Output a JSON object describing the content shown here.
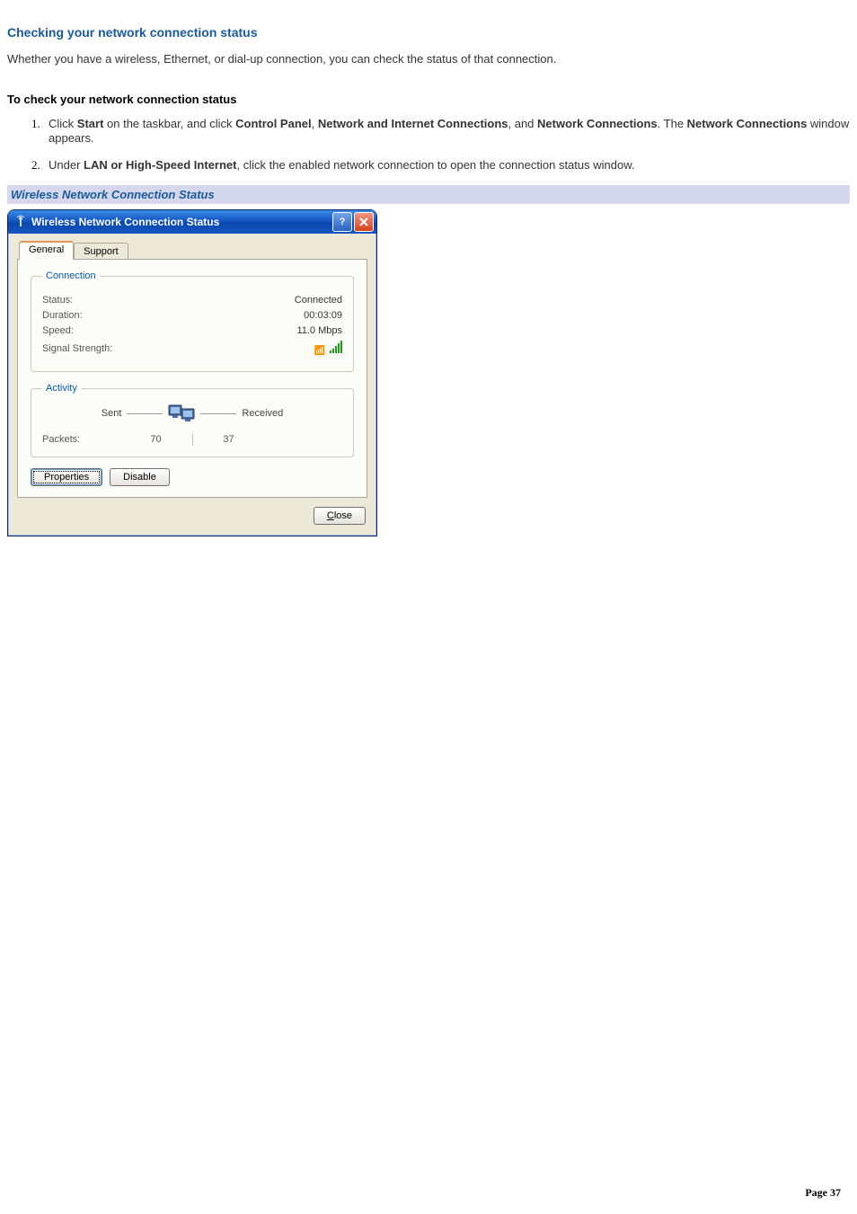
{
  "headings": {
    "main": "Checking your network connection status",
    "intro": "Whether you have a wireless, Ethernet, or dial-up connection, you can check the status of that connection.",
    "subhead": "To check your network connection status",
    "italic_bar": "Wireless Network Connection Status"
  },
  "steps": [
    {
      "parts": [
        {
          "t": "Click "
        },
        {
          "t": "Start",
          "b": true
        },
        {
          "t": " on the taskbar, and click "
        },
        {
          "t": "Control Panel",
          "b": true
        },
        {
          "t": ", "
        },
        {
          "t": "Network and Internet Connections",
          "b": true
        },
        {
          "t": ", and "
        },
        {
          "t": "Network Connections",
          "b": true
        },
        {
          "t": ". The "
        },
        {
          "t": "Network Connections",
          "b": true
        },
        {
          "t": " window appears."
        }
      ]
    },
    {
      "parts": [
        {
          "t": "Under "
        },
        {
          "t": "LAN or High-Speed Internet",
          "b": true
        },
        {
          "t": ", click the enabled network connection to open the connection status window."
        }
      ]
    }
  ],
  "dialog": {
    "title": "Wireless Network Connection Status",
    "tabs": {
      "general": "General",
      "support": "Support"
    },
    "groups": {
      "connection": "Connection",
      "activity": "Activity"
    },
    "conn": {
      "status_label": "Status:",
      "status_value": "Connected",
      "duration_label": "Duration:",
      "duration_value": "00:03:09",
      "speed_label": "Speed:",
      "speed_value": "11.0 Mbps",
      "signal_label": "Signal Strength:"
    },
    "activity": {
      "sent": "Sent",
      "received": "Received",
      "packets_label": "Packets:",
      "packets_sent": "70",
      "packets_received": "37"
    },
    "buttons": {
      "properties": "Properties",
      "disable": "Disable",
      "close": "Close"
    }
  },
  "footer": {
    "label": "Page",
    "num": "37"
  }
}
